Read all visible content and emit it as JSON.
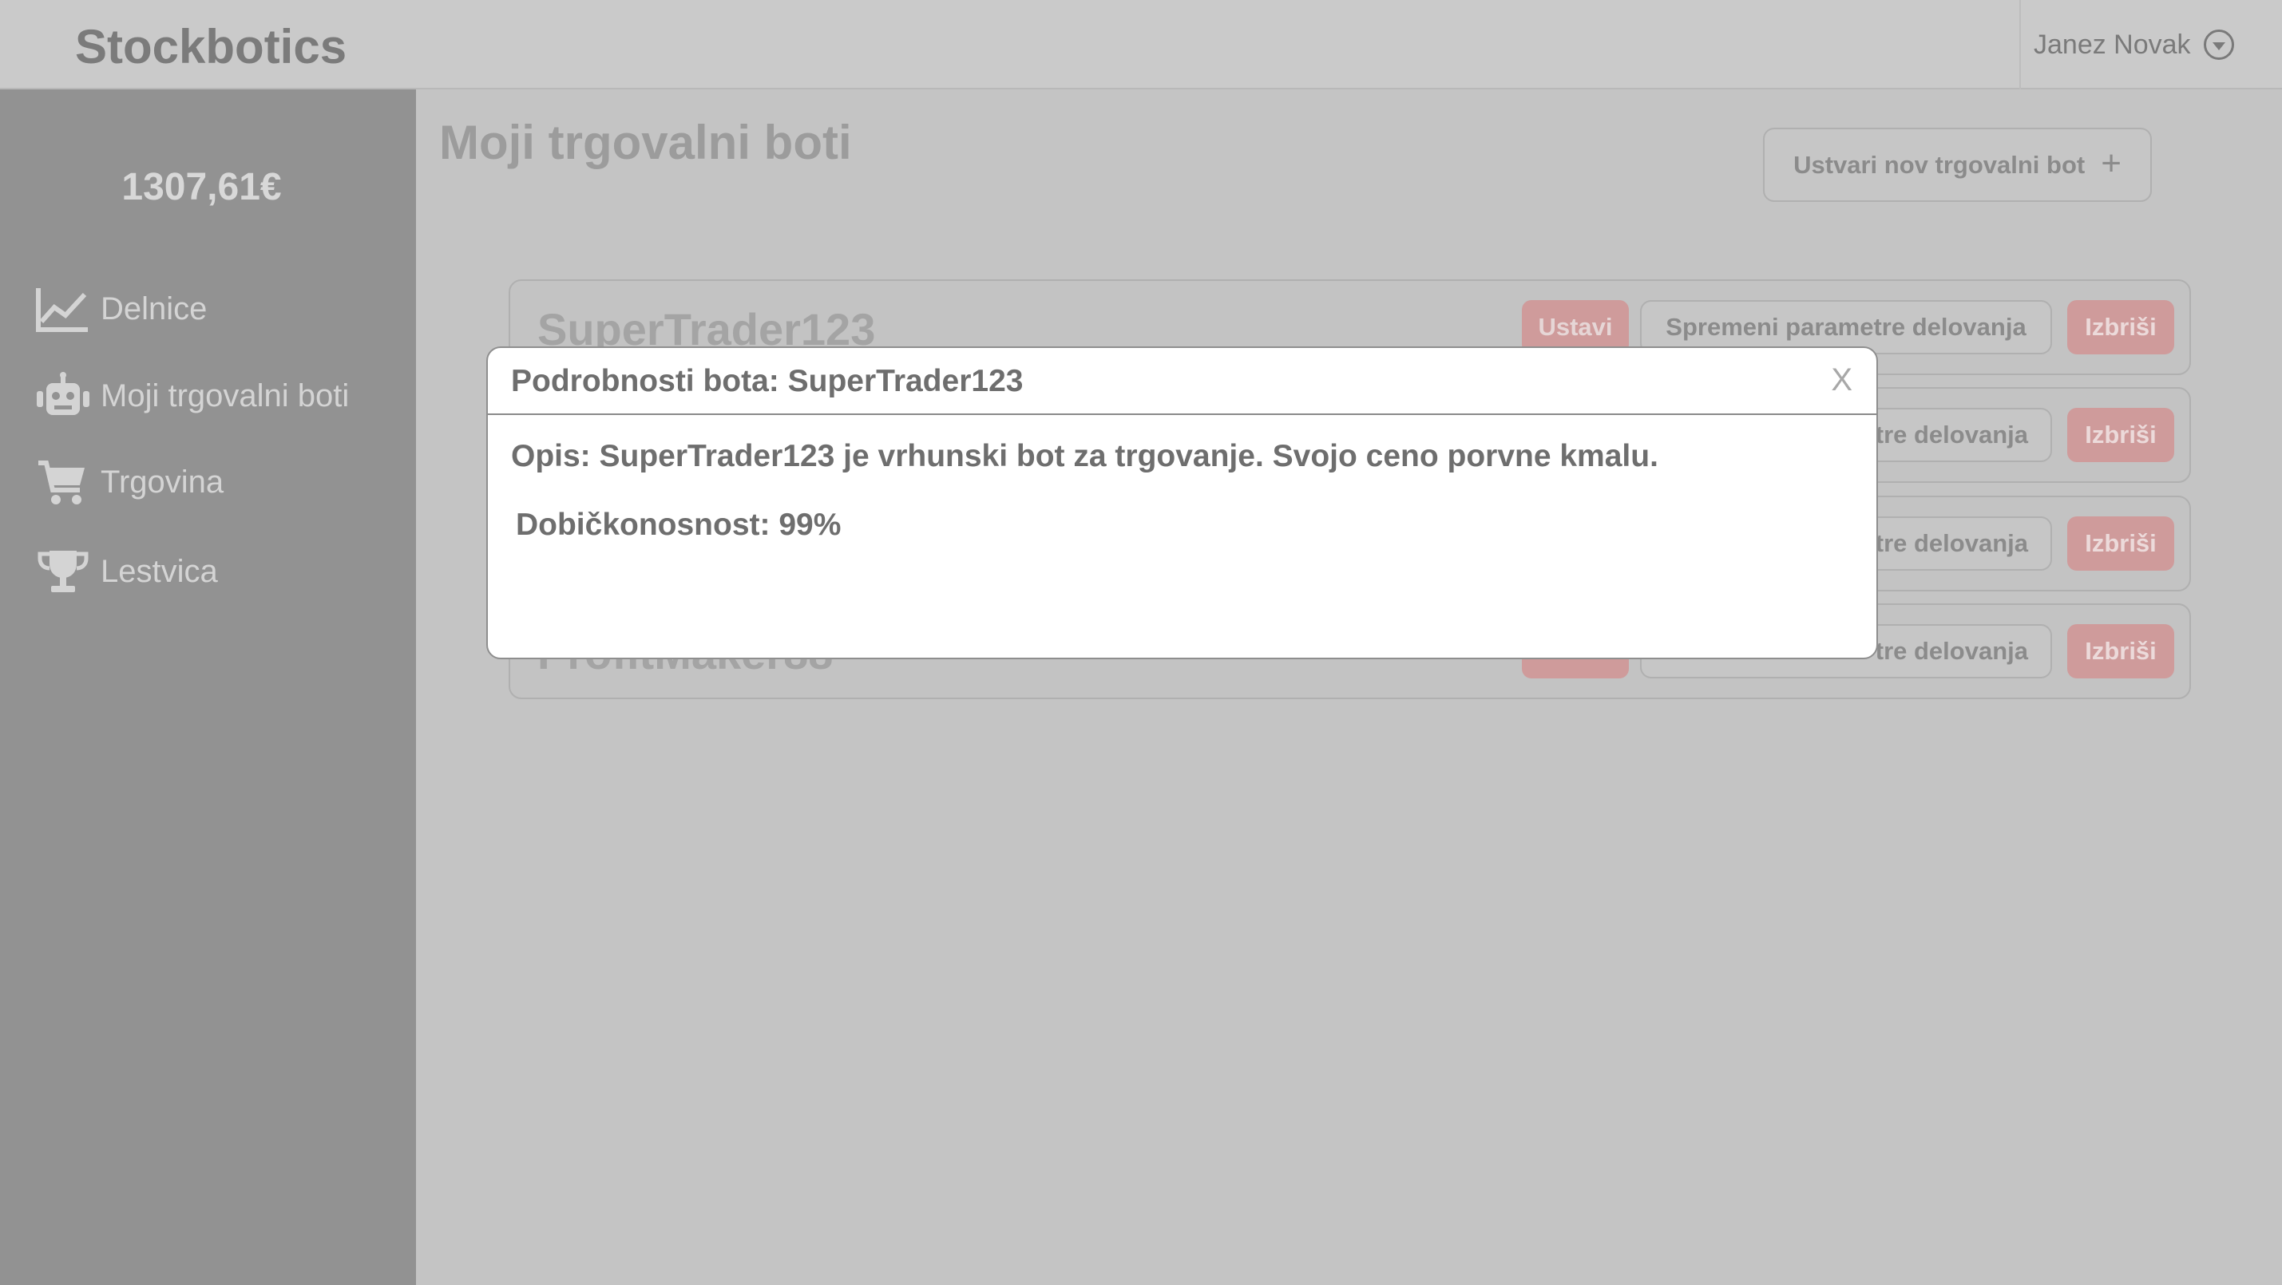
{
  "header": {
    "logo": "Stockbotics",
    "user_name": "Janez Novak"
  },
  "sidebar": {
    "balance": "1307,61€",
    "items": [
      {
        "label": "Delnice",
        "icon": "chart-line-icon"
      },
      {
        "label": "Moji trgovalni boti",
        "icon": "robot-icon"
      },
      {
        "label": "Trgovina",
        "icon": "cart-icon"
      },
      {
        "label": "Lestvica",
        "icon": "trophy-icon"
      }
    ]
  },
  "main": {
    "title": "Moji trgovalni boti",
    "create_button": "Ustvari nov trgovalni bot",
    "create_icon": "+",
    "bots": [
      {
        "name": "SuperTrader123",
        "stop": "Ustavi",
        "params": "Spremeni parametre delovanja",
        "delete": "Izbriši"
      },
      {
        "name": "",
        "stop": "",
        "params": "tre delovanja",
        "delete": "Izbriši"
      },
      {
        "name": "",
        "stop": "",
        "params": "tre delovanja",
        "delete": "Izbriši"
      },
      {
        "name": "ProfitMaker88",
        "stop": "",
        "params": "tre delovanja",
        "delete": "Izbriši"
      }
    ]
  },
  "modal": {
    "title": "Podrobnosti bota: SuperTrader123",
    "close": "X",
    "description": "Opis: SuperTrader123 je vrhunski bot za trgovanje. Svojo ceno porvne kmalu.",
    "profitability": "Dobičkonosnost: 99%"
  },
  "colors": {
    "sidebar": "#929292",
    "danger_button": "#cf9b9b",
    "overlay_bg": "#c4c4c4"
  }
}
